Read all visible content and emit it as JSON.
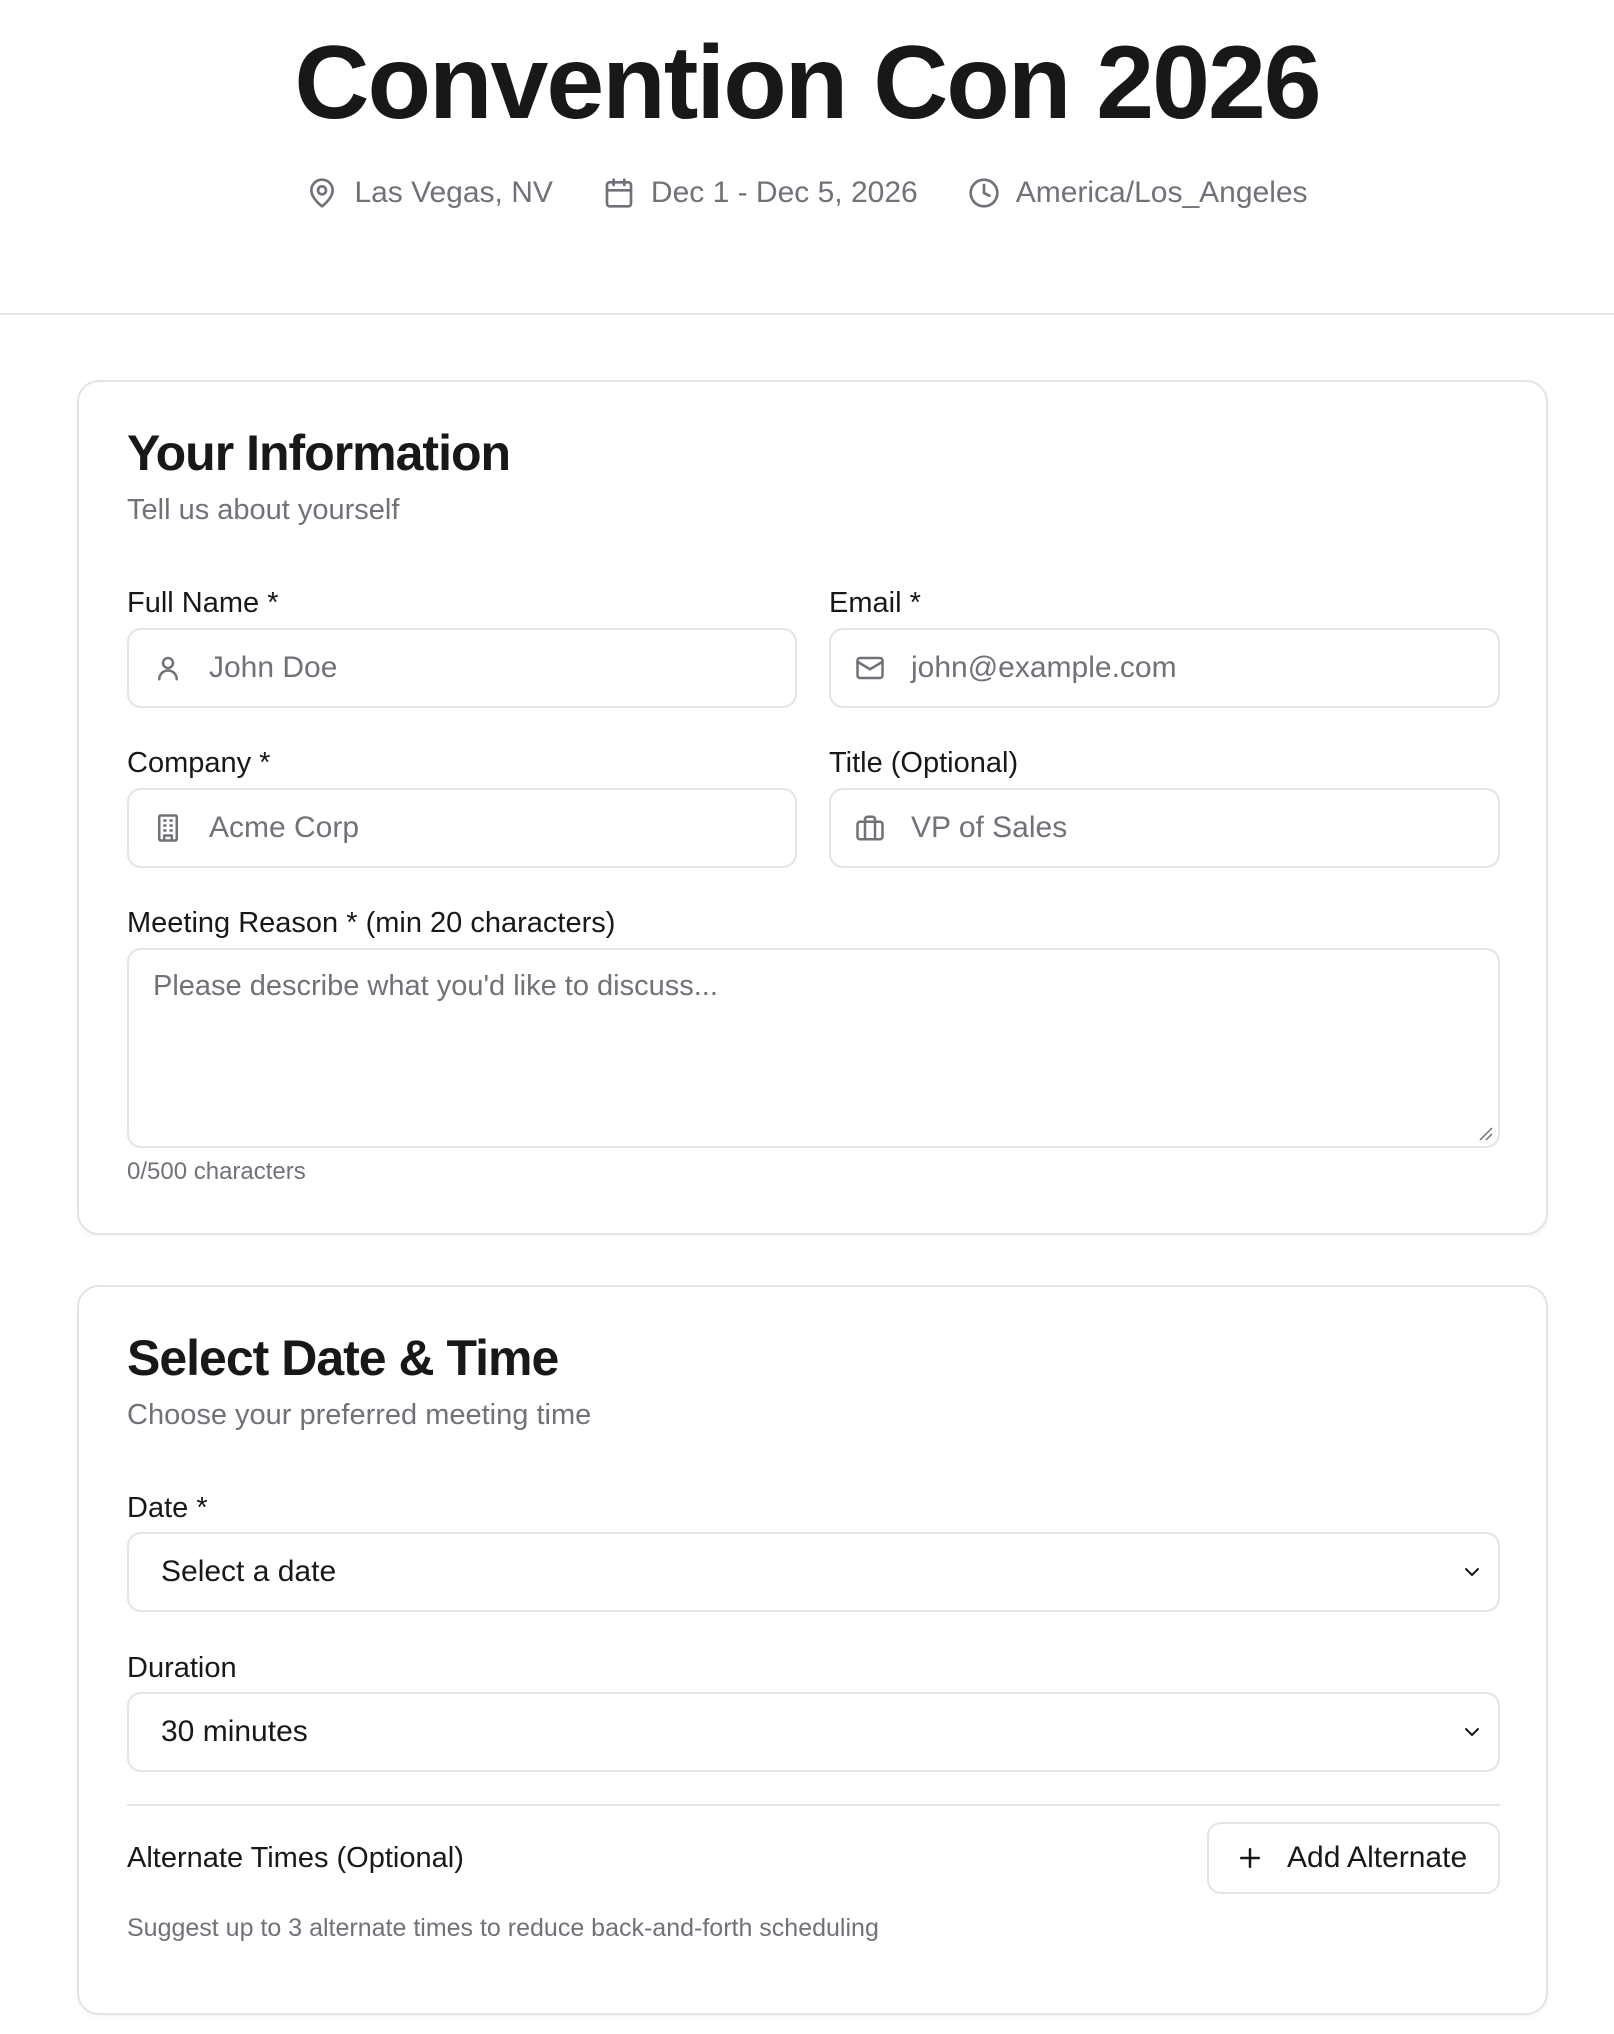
{
  "event": {
    "title": "Convention Con 2026",
    "location": "Las Vegas, NV",
    "dates": "Dec 1 - Dec 5, 2026",
    "timezone": "America/Los_Angeles"
  },
  "info_card": {
    "title": "Your Information",
    "subtitle": "Tell us about yourself",
    "full_name": {
      "label": "Full Name *",
      "placeholder": "John Doe"
    },
    "email": {
      "label": "Email *",
      "placeholder": "john@example.com"
    },
    "company": {
      "label": "Company *",
      "placeholder": "Acme Corp"
    },
    "job_title": {
      "label": "Title (Optional)",
      "placeholder": "VP of Sales"
    },
    "meeting_reason": {
      "label": "Meeting Reason * (min 20 characters)",
      "placeholder": "Please describe what you'd like to discuss...",
      "counter": "0/500 characters"
    }
  },
  "schedule_card": {
    "title": "Select Date & Time",
    "subtitle": "Choose your preferred meeting time",
    "date": {
      "label": "Date *",
      "selected": "Select a date"
    },
    "duration": {
      "label": "Duration",
      "selected": "30 minutes"
    },
    "alternates": {
      "label": "Alternate Times (Optional)",
      "button": "Add Alternate",
      "hint": "Suggest up to 3 alternate times to reduce back-and-forth scheduling"
    }
  },
  "colors": {
    "text": "#18181b",
    "muted": "#71717a",
    "border": "#e4e4e7"
  }
}
